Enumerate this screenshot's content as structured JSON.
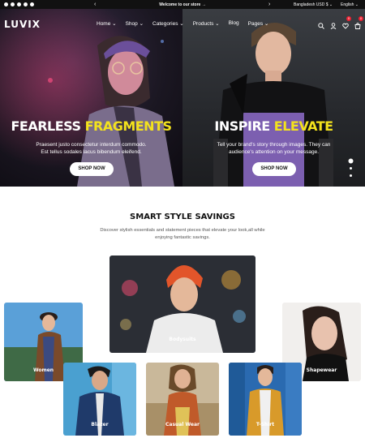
{
  "topbar": {
    "social_icons": [
      "facebook-icon",
      "x-icon",
      "instagram-icon",
      "tiktok-icon",
      "linkedin-icon"
    ],
    "promo_text": "Welcome to our store →",
    "prev_arrow": "‹",
    "next_arrow": "›",
    "currency": "Bangladesh USD $ ⌄",
    "language": "English ⌄"
  },
  "header": {
    "logo": "LUVIX",
    "menu": [
      "Home ⌄",
      "Shop ⌄",
      "Categories ⌄",
      "Products ⌄",
      "Blog",
      "Pages ⌄"
    ],
    "cart_count": "0",
    "wishlist_count": "0"
  },
  "hero": {
    "slides": [
      {
        "headline_main": "FEARLESS ",
        "headline_accent": "FRAGMENTS",
        "subtitle_line1": "Praesent justo consectetur interdum commodo.",
        "subtitle_line2": "Est tellus sodales lacus bibendum eleifend.",
        "button": "SHOP NOW"
      },
      {
        "headline_main": "INSPIRE ",
        "headline_accent": "ELEVATE",
        "subtitle_line1": "Tell your brand's story through images. They can",
        "subtitle_line2": "audience's attention on your message.",
        "button": "SHOP NOW"
      }
    ],
    "accent_color": "#f3e21d"
  },
  "savings": {
    "title": "SMART STYLE SAVINGS",
    "description_line1": "Discover stylish essentials and statement pieces that elevate your look,all while",
    "description_line2": "enjoying fantastic savings."
  },
  "categories": {
    "bodysuits": "Bodysuits",
    "women": "Women",
    "shapewear": "Shapewear",
    "blazer": "Blazer",
    "casual_wear": "Casual Wear",
    "tshirt": "T-Shirt"
  }
}
